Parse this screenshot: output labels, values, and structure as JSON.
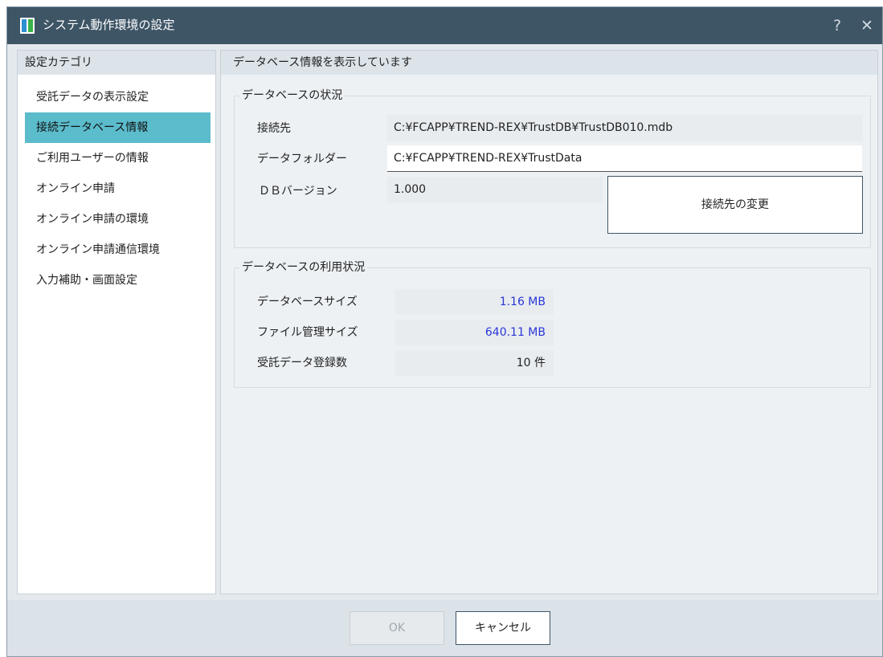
{
  "window": {
    "title": "システム動作環境の設定",
    "help_label": "?",
    "close_label": "✕"
  },
  "sidebar": {
    "heading": "設定カテゴリ",
    "items": [
      {
        "label": "受託データの表示設定"
      },
      {
        "label": "接続データベース情報",
        "selected": true
      },
      {
        "label": "ご利用ユーザーの情報"
      },
      {
        "label": "オンライン申請"
      },
      {
        "label": "オンライン申請の環境"
      },
      {
        "label": "オンライン申請通信環境"
      },
      {
        "label": "入力補助・画面設定"
      }
    ]
  },
  "main": {
    "heading": "データベース情報を表示しています",
    "db_status": {
      "title": "データベースの状況",
      "connection_label": "接続先",
      "connection_value": "C:¥FCAPP¥TREND-REX¥TrustDB¥TrustDB010.mdb",
      "folder_label": "データフォルダー",
      "folder_value": "C:¥FCAPP¥TREND-REX¥TrustData",
      "version_label": "ＤＢバージョン",
      "version_value": "1.000",
      "change_button": "接続先の変更"
    },
    "db_usage": {
      "title": "データベースの利用状況",
      "size_label": "データベースサイズ",
      "size_value": "1.16 MB",
      "file_label": "ファイル管理サイズ",
      "file_value": "640.11 MB",
      "count_label": "受託データ登録数",
      "count_value": "10 件"
    }
  },
  "footer": {
    "ok_label": "OK",
    "ok_enabled": false,
    "cancel_label": "キャンセル"
  },
  "colors": {
    "titlebar": "#3e5566",
    "selected_item": "#5bbccc",
    "value_blue": "#2a36d6",
    "dialog_background": "#e4e9ee"
  }
}
